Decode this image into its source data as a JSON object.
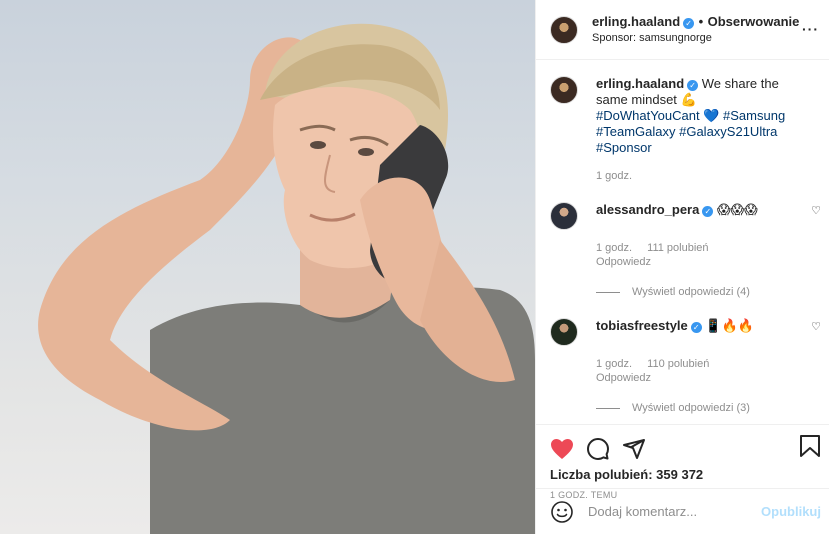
{
  "header": {
    "username": "erling.haaland",
    "separator": "•",
    "follow_label": "Obserwowanie",
    "sponsor": "Sponsor: samsungnorge",
    "more": "···"
  },
  "caption": {
    "username": "erling.haaland",
    "text_start": "We share the same mindset ",
    "emoji_muscle": "💪",
    "hashtag1": "#DoWhatYouCant",
    "emoji_heart": "💙",
    "hashtag2": "#Samsung",
    "hashtag3": "#TeamGalaxy",
    "hashtag4": "#GalaxyS21Ultra",
    "hashtag5": "#Sponsor",
    "time": "1 godz."
  },
  "comments": [
    {
      "username": "alessandro_pera",
      "text": "😱😱😱",
      "time": "1 godz.",
      "likes": "111 polubień",
      "reply": "Odpowiedz",
      "view_replies": "Wyświetl odpowiedzi (4)"
    },
    {
      "username": "tobiasfreestyle",
      "text": "📱🔥🔥",
      "time": "1 godz.",
      "likes": "110 polubień",
      "reply": "Odpowiedz",
      "view_replies": "Wyświetl odpowiedzi (3)"
    }
  ],
  "actions": {
    "likes_label": "Liczba polubień: 359 372",
    "posted": "1 GODZ. TEMU"
  },
  "add_comment": {
    "placeholder": "Dodaj komentarz...",
    "publish": "Opublikuj"
  },
  "colors": {
    "like_red": "#ed4956",
    "verified_blue": "#3897f0",
    "hashtag": "#00376b",
    "publish_disabled": "#b2dffc"
  },
  "icons": [
    "heart-icon",
    "comment-icon",
    "share-icon",
    "bookmark-icon",
    "emoji-icon",
    "verified-icon"
  ]
}
